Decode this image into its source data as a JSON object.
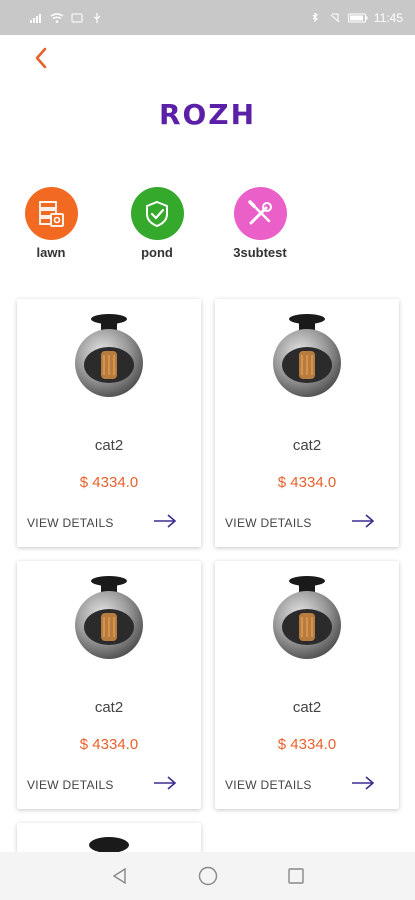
{
  "status_bar": {
    "time": "11:45"
  },
  "header": {
    "brand": "ROZH"
  },
  "categories": [
    {
      "label": "lawn",
      "color": "#f26a21",
      "icon": "server-icon"
    },
    {
      "label": "pond",
      "color": "#35a92b",
      "icon": "shield-check-icon"
    },
    {
      "label": "3subtest",
      "color": "#ea5fc8",
      "icon": "tools-icon"
    }
  ],
  "products": [
    {
      "name": "cat2",
      "price": "$ 4334.0",
      "action": "VIEW DETAILS"
    },
    {
      "name": "cat2",
      "price": "$ 4334.0",
      "action": "VIEW DETAILS"
    },
    {
      "name": "cat2",
      "price": "$ 4334.0",
      "action": "VIEW DETAILS"
    },
    {
      "name": "cat2",
      "price": "$ 4334.0",
      "action": "VIEW DETAILS"
    }
  ],
  "colors": {
    "brand": "#5b1fa8",
    "price": "#e8612c",
    "arrow": "#3b2f8f"
  }
}
